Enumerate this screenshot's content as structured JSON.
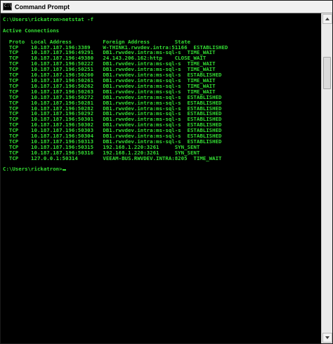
{
  "window": {
    "title": "Command Prompt",
    "icon": "console-icon",
    "icon_glyph": "C:\\"
  },
  "console": {
    "lines": [
      "C:\\Users\\rickatron>netstat -f",
      "",
      "Active Connections",
      "",
      "  Proto  Local Address          Foreign Address        State",
      "  TCP    10.187.187.196:3389    W-THINK1.rwvdev.intra:51166  ESTABLISHED",
      "  TCP    10.187.187.196:49291   DB1.rwvdev.intra:ms-sql-s  TIME_WAIT",
      "  TCP    10.187.187.196:49380   24.143.206.162:http    CLOSE_WAIT",
      "  TCP    10.187.187.196:50222   DB1.rwvdev.intra:ms-sql-s  TIME_WAIT",
      "  TCP    10.187.187.196:50251   DB1.rwvdev.intra:ms-sql-s  TIME_WAIT",
      "  TCP    10.187.187.196:50260   DB1.rwvdev.intra:ms-sql-s  ESTABLISHED",
      "  TCP    10.187.187.196:50261   DB1.rwvdev.intra:ms-sql-s  TIME_WAIT",
      "  TCP    10.187.187.196:50262   DB1.rwvdev.intra:ms-sql-s  TIME_WAIT",
      "  TCP    10.187.187.196:50263   DB1.rwvdev.intra:ms-sql-s  TIME_WAIT",
      "  TCP    10.187.187.196:50272   DB1.rwvdev.intra:ms-sql-s  ESTABLISHED",
      "  TCP    10.187.187.196:50281   DB1.rwvdev.intra:ms-sql-s  ESTABLISHED",
      "  TCP    10.187.187.196:50282   DB1.rwvdev.intra:ms-sql-s  ESTABLISHED",
      "  TCP    10.187.187.196:50292   DB1.rwvdev.intra:ms-sql-s  ESTABLISHED",
      "  TCP    10.187.187.196:50301   DB1.rwvdev.intra:ms-sql-s  ESTABLISHED",
      "  TCP    10.187.187.196:50302   DB1.rwvdev.intra:ms-sql-s  ESTABLISHED",
      "  TCP    10.187.187.196:50303   DB1.rwvdev.intra:ms-sql-s  ESTABLISHED",
      "  TCP    10.187.187.196:50304   DB1.rwvdev.intra:ms-sql-s  ESTABLISHED",
      "  TCP    10.187.187.196:50313   DB1.rwvdev.intra:ms-sql-s  ESTABLISHED",
      "  TCP    10.187.187.196:50315   192.168.1.220:3261     SYN_SENT",
      "  TCP    10.187.187.196:50316   192.168.1.220:3261     SYN_SENT",
      "  TCP    127.0.0.1:50314        VEEAM-BUS.RWVDEV.INTRA:8205  TIME_WAIT",
      ""
    ],
    "prompt": "C:\\Users\\rickatron>",
    "text_color": "#33dd33",
    "background_color": "#000000"
  },
  "scrollbar": {
    "up_icon": "scroll-up-arrow-icon",
    "down_icon": "scroll-down-arrow-icon"
  }
}
